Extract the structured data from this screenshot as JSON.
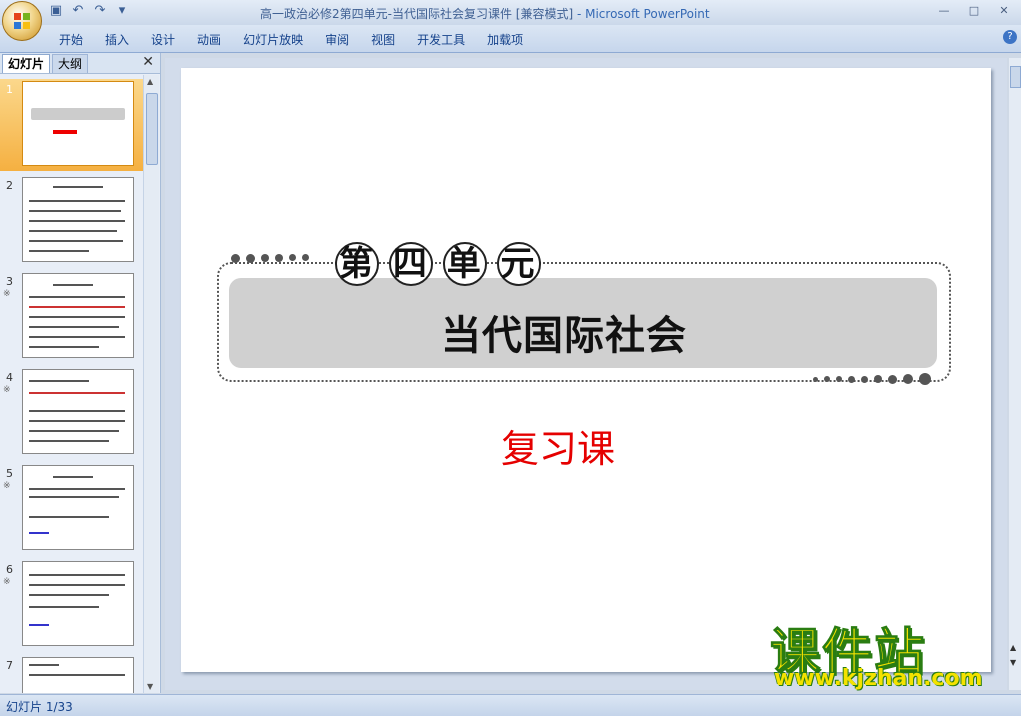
{
  "window": {
    "title": "高一政治必修2第四单元-当代国际社会复习课件 [兼容模式]",
    "app": " - Microsoft PowerPoint",
    "controls": [
      "—",
      "□",
      "✕"
    ]
  },
  "qat": [
    "save-icon",
    "undo-icon",
    "redo-icon",
    "customize-icon"
  ],
  "ribbon": {
    "tabs": [
      "开始",
      "插入",
      "设计",
      "动画",
      "幻灯片放映",
      "审阅",
      "视图",
      "开发工具",
      "加载项"
    ],
    "help": "?"
  },
  "panel": {
    "tab_slides": "幻灯片",
    "tab_outline": "大纲",
    "close": "✕",
    "slides": [
      {
        "num": "1"
      },
      {
        "num": "2"
      },
      {
        "num": "3",
        "anim": "※"
      },
      {
        "num": "4",
        "anim": "※"
      },
      {
        "num": "5",
        "anim": "※"
      },
      {
        "num": "6",
        "anim": "※"
      },
      {
        "num": "7"
      }
    ]
  },
  "slide": {
    "unit_number": [
      "第",
      "四",
      "单",
      "元"
    ],
    "unit_name": "当代国际社会",
    "subtitle": "复习课"
  },
  "status": {
    "slide_info": "幻灯片 1/33"
  },
  "watermark": {
    "big": "课件站",
    "url": "www.kjzhan.com"
  },
  "colors": {
    "ribbon_text": "#15428b",
    "selected_thumb": "#f5b041",
    "subtitle_red": "#e50000",
    "watermark_yellow": "#f4e200"
  }
}
